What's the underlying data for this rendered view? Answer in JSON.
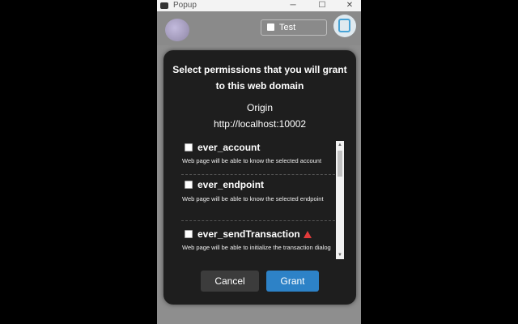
{
  "window": {
    "title": "Popup",
    "minimize_glyph": "─",
    "maximize_glyph": "☐",
    "close_glyph": "✕"
  },
  "header": {
    "network_label": "Test",
    "avatar_icon": "avatar-icon",
    "account_icon": "account-icon"
  },
  "dialog": {
    "title": "Select permissions that you will grant to this web domain",
    "origin_label": "Origin",
    "origin_url": "http://localhost:10002",
    "permissions": [
      {
        "name": "ever_account",
        "description": "Web page will be able to know the selected account",
        "checked": false
      },
      {
        "name": "ever_endpoint",
        "description": "Web page will be able to know the selected endpoint",
        "checked": false
      },
      {
        "name": "ever_sendTransaction",
        "description": "Web page will be able to initialize the transaction dialog",
        "checked": false,
        "warning": true
      }
    ],
    "cancel_label": "Cancel",
    "grant_label": "Grant"
  },
  "colors": {
    "dialog_background": "#1e1e1e",
    "grant_button": "#2d82c7",
    "cancel_button": "#3c3c3c",
    "warning": "#e23b3b"
  }
}
